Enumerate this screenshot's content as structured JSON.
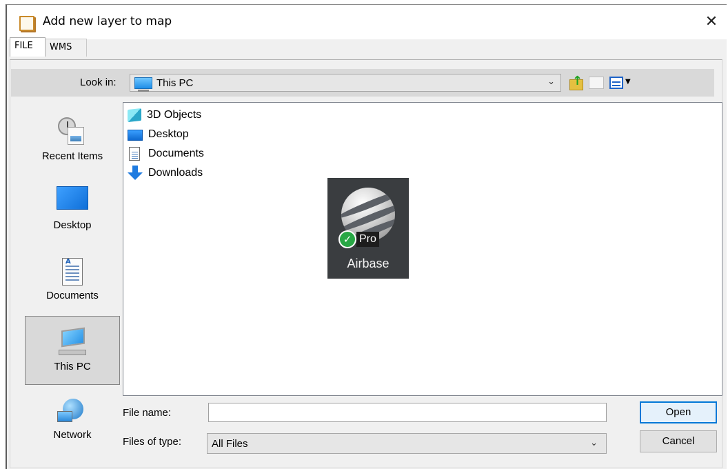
{
  "window": {
    "title": "Add new layer to map",
    "close_glyph": "✕"
  },
  "tabs": [
    {
      "label": "FILE"
    },
    {
      "label": "WMS"
    }
  ],
  "lookin": {
    "label": "Look in:",
    "value": "This PC",
    "icon": "this-pc-icon"
  },
  "toolbar": {
    "up_icon": "up-folder-icon",
    "new_folder_icon": "new-folder-icon",
    "view_icon": "view-menu-icon"
  },
  "places": [
    {
      "label": "Recent Items",
      "icon": "recent-items-icon"
    },
    {
      "label": "Desktop",
      "icon": "desktop-icon"
    },
    {
      "label": "Documents",
      "icon": "documents-icon"
    },
    {
      "label": "This PC",
      "icon": "this-pc-icon",
      "selected": true
    },
    {
      "label": "Network",
      "icon": "network-icon"
    }
  ],
  "files": [
    {
      "label": "3D Objects",
      "icon": "3d-objects-icon"
    },
    {
      "label": "Desktop",
      "icon": "desktop-icon"
    },
    {
      "label": "Documents",
      "icon": "documents-icon"
    },
    {
      "label": "Downloads",
      "icon": "downloads-icon"
    }
  ],
  "overlay": {
    "app_badge": "Pro",
    "app_name": "Airbase",
    "icon": "google-earth-pro-icon"
  },
  "form": {
    "filename_label": "File name:",
    "filename_value": "",
    "filetype_label": "Files of type:",
    "filetype_value": "All Files"
  },
  "buttons": {
    "open": "Open",
    "cancel": "Cancel"
  },
  "colors": {
    "accent": "#0078d7",
    "dialog_bg": "#f0f0f0",
    "toolbar_bg": "#d9d9d9"
  }
}
